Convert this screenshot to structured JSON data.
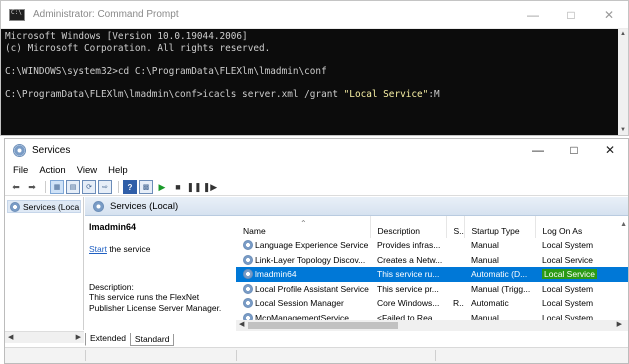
{
  "cmd": {
    "title": "Administrator: Command Prompt",
    "lines": [
      "Microsoft Windows [Version 10.0.19044.2006]",
      "(c) Microsoft Corporation. All rights reserved.",
      "",
      "C:\\WINDOWS\\system32>cd C:\\ProgramData\\FLEXlm\\lmadmin\\conf",
      "",
      "C:\\ProgramData\\FLEXlm\\lmadmin\\conf>icacls server.xml /grant "
    ],
    "quoted": "\"Local Service\"",
    "tail": ":M"
  },
  "services": {
    "title": "Services",
    "menu": [
      "File",
      "Action",
      "View",
      "Help"
    ],
    "tree_node": "Services (Loca",
    "pane_header": "Services (Local)",
    "detail": {
      "service_name": "lmadmin64",
      "start_link": "Start",
      "start_suffix": " the service",
      "description_label": "Description:",
      "description_text": "This service runs the FlexNet Publisher License Server Manager."
    },
    "columns": [
      "Name",
      "Description",
      "S...",
      "Startup Type",
      "Log On As"
    ],
    "rows": [
      {
        "name": "Language Experience Service",
        "description": "Provides infras...",
        "status": "",
        "startup": "Manual",
        "logon": "Local System",
        "selected": false
      },
      {
        "name": "Link-Layer Topology Discov...",
        "description": "Creates a Netw...",
        "status": "",
        "startup": "Manual",
        "logon": "Local Service",
        "selected": false
      },
      {
        "name": "lmadmin64",
        "description": "This service ru...",
        "status": "",
        "startup": "Automatic (D...",
        "logon": "Local Service",
        "selected": true
      },
      {
        "name": "Local Profile Assistant Service",
        "description": "This service pr...",
        "status": "",
        "startup": "Manual (Trigg...",
        "logon": "Local System",
        "selected": false
      },
      {
        "name": "Local Session Manager",
        "description": "Core Windows...",
        "status": "R...",
        "startup": "Automatic",
        "logon": "Local System",
        "selected": false
      },
      {
        "name": "McpManagementService",
        "description": "<Failed to Rea...",
        "status": "",
        "startup": "Manual",
        "logon": "Local System",
        "selected": false
      }
    ],
    "tabs": [
      "Extended",
      "Standard"
    ]
  }
}
